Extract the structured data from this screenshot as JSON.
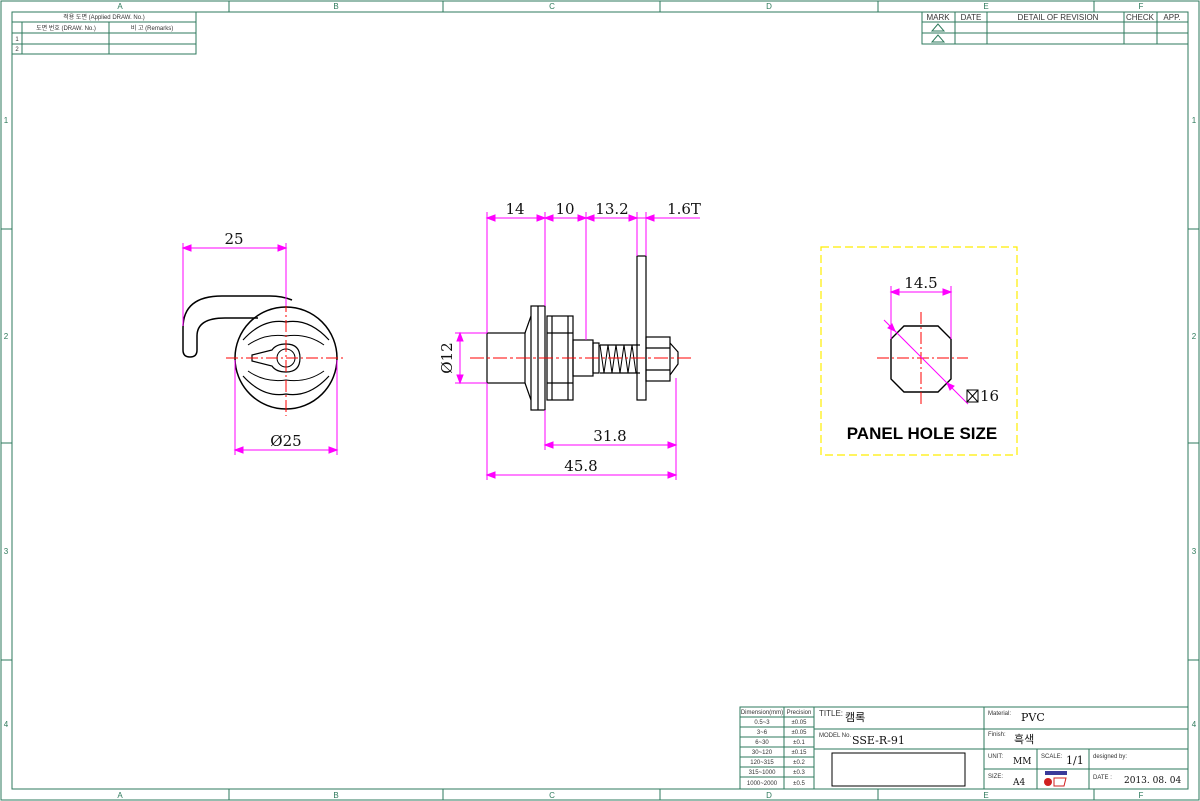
{
  "frame": {
    "col_labels": [
      "A",
      "B",
      "C",
      "D",
      "E",
      "F"
    ],
    "row_labels": [
      "1",
      "2",
      "3",
      "4"
    ]
  },
  "applied_table": {
    "header": "적용 도면 (Applied DRAW. No.)",
    "col1": "도면 번호 (DRAW. No.)",
    "col2": "비 고 (Remarks)",
    "rows": [
      "1",
      "2"
    ]
  },
  "revision_table": {
    "headers": [
      "MARK",
      "DATE",
      "DETAIL OF REVISION",
      "CHECK",
      "APP."
    ]
  },
  "views": {
    "front": {
      "dim_width": "25",
      "dim_diameter": "Ø25"
    },
    "side": {
      "dim_top": [
        "14",
        "10",
        "13.2",
        "1.6T"
      ],
      "dim_diameter": "Ø12",
      "dim_318": "31.8",
      "dim_458": "45.8"
    },
    "panel": {
      "dim_width": "14.5",
      "dim_square": "16",
      "label": "PANEL HOLE SIZE"
    }
  },
  "tolerance_table": {
    "headers": [
      "Dimension(mm)",
      "Precision"
    ],
    "rows": [
      [
        "0.5~3",
        "±0.05"
      ],
      [
        "3~6",
        "±0.05"
      ],
      [
        "6~30",
        "±0.1"
      ],
      [
        "30~120",
        "±0.15"
      ],
      [
        "120~315",
        "±0.2"
      ],
      [
        "315~1000",
        "±0.3"
      ],
      [
        "1000~2000",
        "±0.5"
      ]
    ]
  },
  "title_block": {
    "title_label": "TITLE:",
    "title": "캠록",
    "model_label": "MODEL No.",
    "model": "SSE-R-91",
    "material_label": "Material:",
    "material": "PVC",
    "finish_label": "Finish:",
    "finish": "흑색",
    "unit_label": "UNIT:",
    "unit": "MM",
    "scale_label": "SCALE:",
    "scale": "1/1",
    "designed_label": "designed by:",
    "size_label": "SIZE:",
    "size": "A4",
    "date_label": "DATE :",
    "date": "2013. 08. 04"
  },
  "colors": {
    "frame": "#2e7a5c",
    "dimension": "#ff00ff",
    "centerline": "#ff0000",
    "outline": "#000000",
    "panel_box": "#ffee00"
  }
}
